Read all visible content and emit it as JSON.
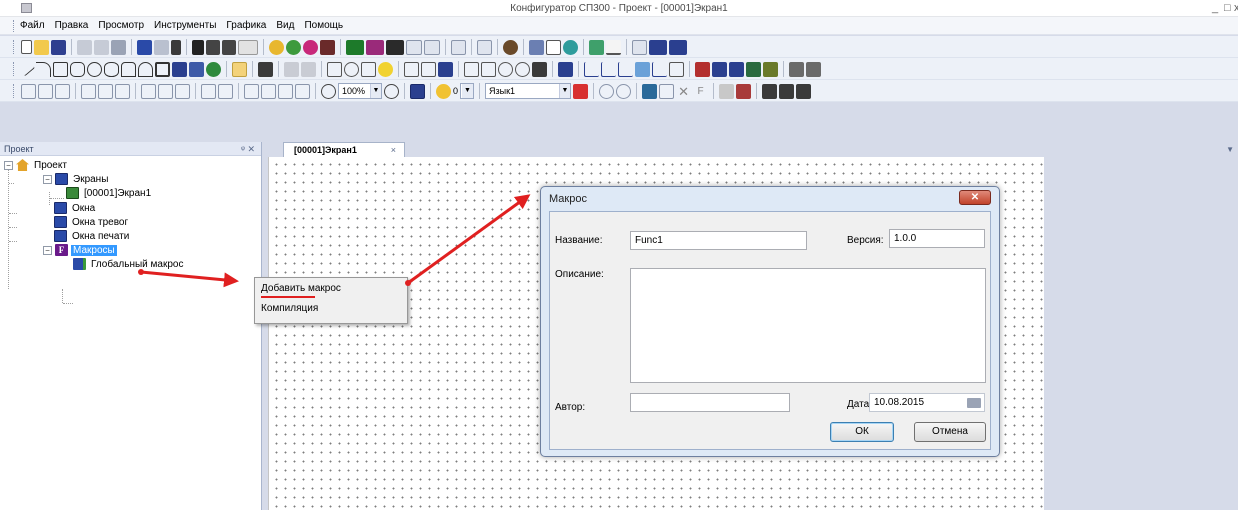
{
  "window": {
    "title": "Конфигуратор СП300 - Проект - [00001]Экран1",
    "minimize": "_",
    "maximize": "□",
    "close": "x"
  },
  "menu": [
    "Файл",
    "Правка",
    "Просмотр",
    "Инструменты",
    "Графика",
    "Вид",
    "Помощь"
  ],
  "toolbar4": {
    "zoom": "100%",
    "layer": "0",
    "language": "Язык1"
  },
  "project_panel": {
    "title": "Проект",
    "pin": "ᵠ",
    "close": "✕"
  },
  "tree": {
    "root": "Проект",
    "screens": "Экраны",
    "screen1": "[00001]Экран1",
    "windows": "Окна",
    "alarm_windows": "Окна тревог",
    "print_windows": "Окна печати",
    "macros": "Макросы",
    "global_macro": "Глобальный макрос",
    "collapse_sign": "−",
    "macro_icon_letter": "F"
  },
  "document_tab": {
    "label": "[00001]Экран1",
    "close": "×"
  },
  "context_menu": {
    "add_macro": "Добавить макрос",
    "compile": "Компиляция"
  },
  "dialog": {
    "title": "Макрос",
    "close": "✕",
    "name_label": "Название:",
    "name_value": "Func1",
    "version_label": "Версия:",
    "version_value": "1.0.0",
    "description_label": "Описание:",
    "description_value": "",
    "author_label": "Автор:",
    "author_value": "",
    "date_label": "Дата",
    "date_value": "10.08.2015",
    "ok": "ОК",
    "cancel": "Отмена"
  },
  "colors": {
    "arrow": "#e02020",
    "selection": "#3399ff",
    "workspace": "#d6dbe9"
  }
}
